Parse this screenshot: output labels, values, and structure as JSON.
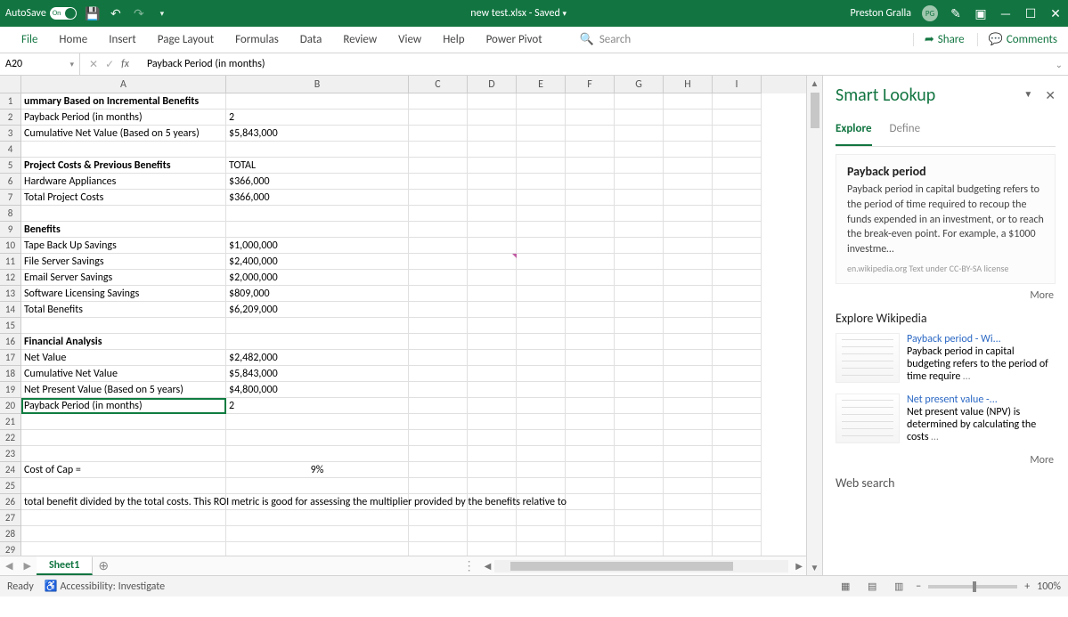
{
  "titlebar": {
    "autosave": "AutoSave",
    "toggle_state": "On",
    "filename": "new test.xlsx",
    "save_state": "Saved",
    "user": "Preston Gralla",
    "initials": "PG"
  },
  "ribbon": {
    "tabs": [
      "File",
      "Home",
      "Insert",
      "Page Layout",
      "Formulas",
      "Data",
      "Review",
      "View",
      "Help",
      "Power Pivot"
    ],
    "search_placeholder": "Search",
    "share": "Share",
    "comments": "Comments"
  },
  "formula_bar": {
    "name_box": "A20",
    "formula": "Payback Period (in months)"
  },
  "columns": [
    "A",
    "B",
    "C",
    "D",
    "E",
    "F",
    "G",
    "H",
    "I"
  ],
  "col_widths": {
    "A": 230,
    "B": 205,
    "C": 66,
    "D": 55,
    "E": 55,
    "F": 55,
    "G": 55,
    "H": 55,
    "I": 55
  },
  "rows": [
    {
      "n": 1,
      "A": "ummary Based on Incremental Benefits",
      "Abold": true
    },
    {
      "n": 2,
      "A": "Payback Period (in months)",
      "B": "2"
    },
    {
      "n": 3,
      "A": "Cumulative Net Value  (Based on 5 years)",
      "B": "$5,843,000"
    },
    {
      "n": 4
    },
    {
      "n": 5,
      "A": "Project Costs & Previous Benefits",
      "Abold": true,
      "B": "TOTAL"
    },
    {
      "n": 6,
      "A": "Hardware Appliances",
      "B": "$366,000"
    },
    {
      "n": 7,
      "A": "Total Project Costs",
      "B": "$366,000"
    },
    {
      "n": 8
    },
    {
      "n": 9,
      "A": "Benefits",
      "Abold": true
    },
    {
      "n": 10,
      "A": "Tape Back Up Savings",
      "B": "$1,000,000"
    },
    {
      "n": 11,
      "A": "File Server Savings",
      "B": "$2,400,000"
    },
    {
      "n": 12,
      "A": "Email Server Savings",
      "B": "$2,000,000"
    },
    {
      "n": 13,
      "A": "Software Licensing Savings",
      "B": "$809,000"
    },
    {
      "n": 14,
      "A": "Total Benefits",
      "B": "$6,209,000"
    },
    {
      "n": 15
    },
    {
      "n": 16,
      "A": "Financial Analysis",
      "Abold": true
    },
    {
      "n": 17,
      "A": "Net Value",
      "B": "$2,482,000"
    },
    {
      "n": 18,
      "A": "Cumulative Net Value",
      "B": "$5,843,000"
    },
    {
      "n": 19,
      "A": "Net Present Value (Based on 5 years)",
      "B": "$4,800,000"
    },
    {
      "n": 20,
      "A": "Payback Period (in months)",
      "B": "2",
      "selected": true
    },
    {
      "n": 21
    },
    {
      "n": 22
    },
    {
      "n": 23
    },
    {
      "n": 24,
      "A": "Cost of Cap =",
      "B": "9%",
      "Bcenter": true
    },
    {
      "n": 25
    },
    {
      "n": 26,
      "A": "total benefit divided by the total costs.  This ROI metric is good for assessing the multiplier provided by the benefits relative to",
      "Atextleft": true,
      "Awide": true
    },
    {
      "n": 27
    },
    {
      "n": 28
    },
    {
      "n": 29
    }
  ],
  "pane": {
    "title": "Smart Lookup",
    "tab_explore": "Explore",
    "tab_define": "Define",
    "card_title": "Payback period",
    "card_body": "Payback period in capital budgeting refers to the period of time required to recoup the funds expended in an investment, or to reach the break-even point. For example, a $1000 investme",
    "card_meta": "en.wikipedia.org  Text under CC-BY-SA license",
    "more": "More",
    "explore_wiki": "Explore Wikipedia",
    "items": [
      {
        "title": "Payback period - Wi...",
        "body": "Payback period in capital budgeting refers to the period of time require"
      },
      {
        "title": "Net present value -...",
        "body": "Net present value (NPV) is determined by calculating the costs"
      }
    ],
    "web_search": "Web search"
  },
  "sheet_tabs": {
    "active": "Sheet1"
  },
  "status": {
    "ready": "Ready",
    "accessibility": "Accessibility: Investigate",
    "zoom": "100%"
  }
}
